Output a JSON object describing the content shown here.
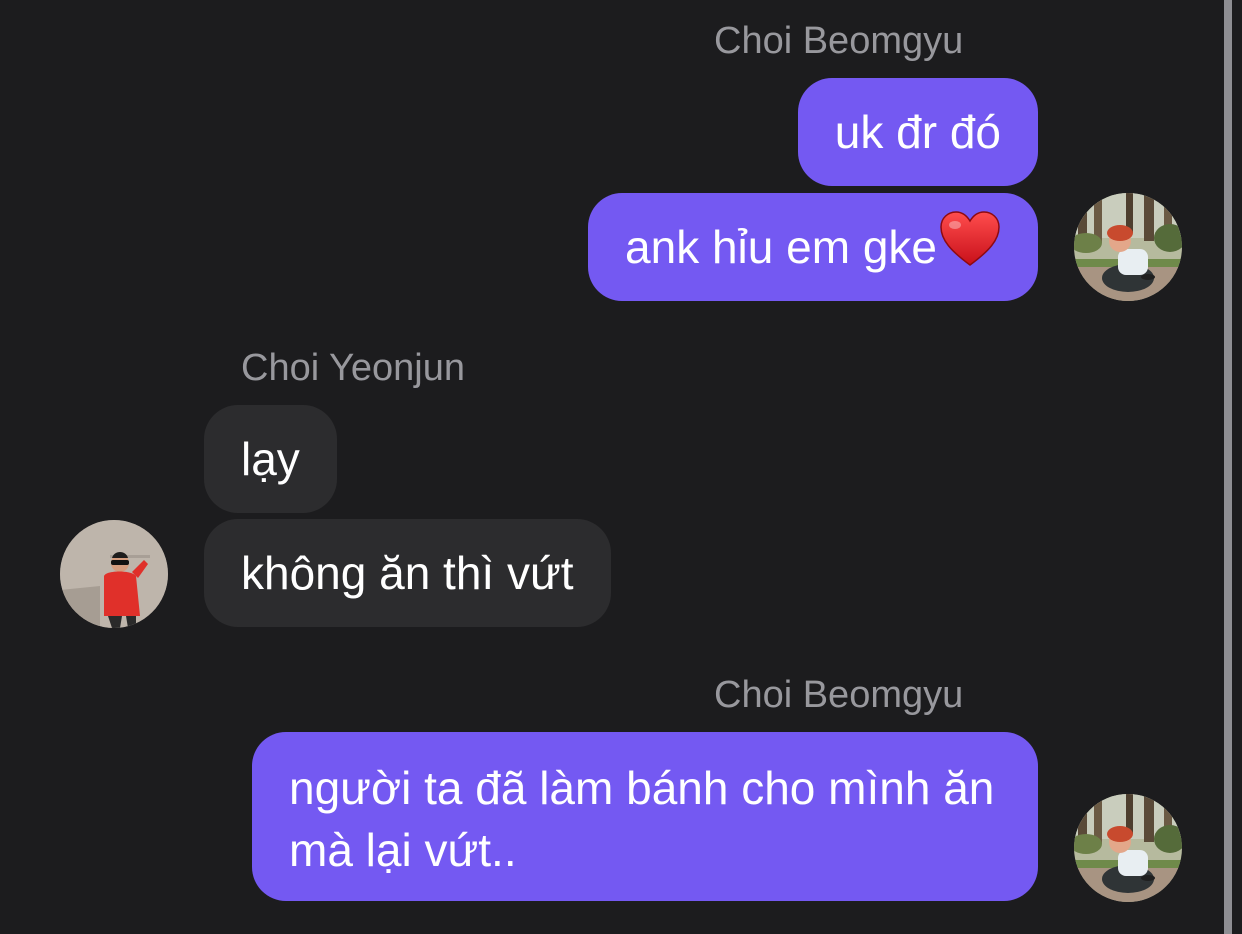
{
  "conversation": {
    "groups": [
      {
        "sender": "Choi Beomgyu",
        "messages": [
          "uk đr đó",
          "ank hỉu em gke"
        ],
        "emoji": "heart-emoji",
        "avatar": "avatar-beomgyu"
      },
      {
        "sender": "Choi Yeonjun",
        "messages": [
          "lạy",
          "không ăn thì vứt"
        ],
        "avatar": "avatar-yeonjun"
      },
      {
        "sender": "Choi Beomgyu",
        "messages": [
          "người ta đã làm bánh cho mình ăn mà lại vứt.."
        ],
        "avatar": "avatar-beomgyu"
      }
    ]
  },
  "colors": {
    "background": "#1c1c1e",
    "outgoing_bubble": "#7459f2",
    "incoming_bubble": "#2c2c2e",
    "sender_name": "#98989d",
    "message_text": "#ffffff"
  }
}
